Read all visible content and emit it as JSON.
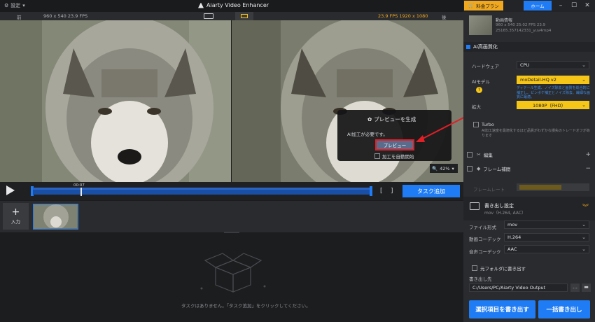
{
  "titlebar": {
    "settings_label": "設定",
    "app_title": "Aiarty Video Enhancer"
  },
  "topright": {
    "pricing_label": "料金プラン",
    "home_label": "ホーム"
  },
  "preview_header": {
    "before_label": "前",
    "before_info": "960 x 540  23.9 FPS",
    "after_info": "23.9 FPS  1920 x 1080",
    "after_label": "後"
  },
  "preview_dialog": {
    "title": "プレビューを生成",
    "message": "AI加工が必要です。",
    "preview_button": "プレビュー",
    "auto_start_label": "加工を自動開始"
  },
  "zoom": {
    "value": "42%"
  },
  "timeline": {
    "time_label": "00:07",
    "progress": 0.14,
    "task_add_label": "タスク追加"
  },
  "clipstrip": {
    "input_label": "入力"
  },
  "taskarea": {
    "empty_message": "タスクはありません。「タスク追加」をクリックしてください。"
  },
  "video_info": {
    "title": "動画情報",
    "line1": "960 x 540   25:02   FPS 23.9",
    "line2": "25165.357142331_yuv4mp4"
  },
  "ai_enhance": {
    "section_title": "AI高画質化",
    "hardware_label": "ハードウェア",
    "hardware_value": "CPU",
    "ai_model_label": "AIモデル",
    "ai_model_value": "moDetail-HQ v2",
    "ai_model_desc": "ディテール生成、ノイズ除去と画質を総合的に補正し、ピンボケ補正とノイズ除去、繊細な画質に最適。",
    "scale_label": "拡大",
    "scale_value": "1080P（FHD）",
    "turbo_label": "Turbo",
    "turbo_desc": "AI加工速度を最適化するほど品質がわずかな損失のトレードオフがあります"
  },
  "sections": {
    "edit_label": "編集",
    "frame_interp_label": "フレーム補間",
    "frame_rate_label": "フレームレート"
  },
  "export_settings": {
    "title": "書き出し設定",
    "subtitle": "mov（H.264, AAC）",
    "file_format_label": "ファイル形式",
    "file_format_value": "mov",
    "video_codec_label": "動画コーデック",
    "video_codec_value": "H.264",
    "audio_codec_label": "音声コーデック",
    "audio_codec_value": "AAC",
    "original_folder_label": "元フォルダに書き出す",
    "output_label": "書き出し先",
    "output_path": "C:/Users/PC/Aiarty Video Output",
    "export_selected_label": "選択項目を書き出す",
    "export_all_label": "一括書き出し"
  },
  "colors": {
    "accent_blue": "#1f7cf5",
    "pricing_orange": "#f0a81e",
    "highlight_red": "#e01f26",
    "selected_yellow": "#f5c518"
  }
}
